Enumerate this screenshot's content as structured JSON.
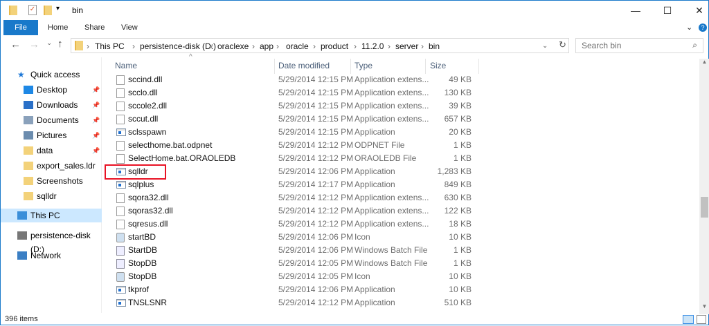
{
  "window": {
    "title": "bin",
    "minimize": "—",
    "maximize": "☐",
    "close": "✕"
  },
  "ribbon": {
    "tabs": [
      "File",
      "Home",
      "Share",
      "View"
    ],
    "expand": "⌄",
    "help": "?"
  },
  "nav": {
    "back": "←",
    "forward": "→",
    "recent": "⌄",
    "up": "↑",
    "refresh": "↻",
    "breadcrumbs": [
      "This PC",
      "persistence-disk (D:)",
      "oraclexe",
      "app",
      "oracle",
      "product",
      "11.2.0",
      "server",
      "bin"
    ],
    "search_placeholder": "Search bin"
  },
  "sidebar": [
    {
      "label": "Quick access",
      "icon": "star-icon"
    },
    {
      "label": "Desktop",
      "icon": "desktop-icon",
      "pinned": true
    },
    {
      "label": "Downloads",
      "icon": "download-icon",
      "pinned": true
    },
    {
      "label": "Documents",
      "icon": "documents-icon",
      "pinned": true
    },
    {
      "label": "Pictures",
      "icon": "pictures-icon",
      "pinned": true
    },
    {
      "label": "data",
      "icon": "folder-icon",
      "pinned": true
    },
    {
      "label": "export_sales.ldr",
      "icon": "folder-icon"
    },
    {
      "label": "Screenshots",
      "icon": "folder-icon"
    },
    {
      "label": "sqlldr",
      "icon": "folder-icon"
    },
    {
      "label": "This PC",
      "icon": "computer-icon",
      "selected": true
    },
    {
      "label": "persistence-disk (D:)",
      "icon": "drive-icon"
    },
    {
      "label": "Network",
      "icon": "network-icon"
    }
  ],
  "columns": [
    "Name",
    "Date modified",
    "Type",
    "Size"
  ],
  "files": [
    {
      "name": "sccind.dll",
      "date": "5/29/2014 12:15 PM",
      "type": "Application extens...",
      "size": "49 KB",
      "kind": "dll"
    },
    {
      "name": "scclo.dll",
      "date": "5/29/2014 12:15 PM",
      "type": "Application extens...",
      "size": "130 KB",
      "kind": "dll"
    },
    {
      "name": "sccole2.dll",
      "date": "5/29/2014 12:15 PM",
      "type": "Application extens...",
      "size": "39 KB",
      "kind": "dll"
    },
    {
      "name": "sccut.dll",
      "date": "5/29/2014 12:15 PM",
      "type": "Application extens...",
      "size": "657 KB",
      "kind": "dll"
    },
    {
      "name": "sclsspawn",
      "date": "5/29/2014 12:15 PM",
      "type": "Application",
      "size": "20 KB",
      "kind": "app"
    },
    {
      "name": "selecthome.bat.odpnet",
      "date": "5/29/2014 12:12 PM",
      "type": "ODPNET File",
      "size": "1 KB",
      "kind": "file"
    },
    {
      "name": "SelectHome.bat.ORAOLEDB",
      "date": "5/29/2014 12:12 PM",
      "type": "ORAOLEDB File",
      "size": "1 KB",
      "kind": "file"
    },
    {
      "name": "sqlldr",
      "date": "5/29/2014 12:06 PM",
      "type": "Application",
      "size": "1,283 KB",
      "kind": "app"
    },
    {
      "name": "sqlplus",
      "date": "5/29/2014 12:17 PM",
      "type": "Application",
      "size": "849 KB",
      "kind": "app"
    },
    {
      "name": "sqora32.dll",
      "date": "5/29/2014 12:12 PM",
      "type": "Application extens...",
      "size": "630 KB",
      "kind": "dll"
    },
    {
      "name": "sqoras32.dll",
      "date": "5/29/2014 12:12 PM",
      "type": "Application extens...",
      "size": "122 KB",
      "kind": "dll"
    },
    {
      "name": "sqresus.dll",
      "date": "5/29/2014 12:12 PM",
      "type": "Application extens...",
      "size": "18 KB",
      "kind": "dll"
    },
    {
      "name": "startBD",
      "date": "5/29/2014 12:06 PM",
      "type": "Icon",
      "size": "10 KB",
      "kind": "ico"
    },
    {
      "name": "StartDB",
      "date": "5/29/2014 12:06 PM",
      "type": "Windows Batch File",
      "size": "1 KB",
      "kind": "bat"
    },
    {
      "name": "StopDB",
      "date": "5/29/2014 12:05 PM",
      "type": "Windows Batch File",
      "size": "1 KB",
      "kind": "bat"
    },
    {
      "name": "StopDB",
      "date": "5/29/2014 12:05 PM",
      "type": "Icon",
      "size": "10 KB",
      "kind": "ico"
    },
    {
      "name": "tkprof",
      "date": "5/29/2014 12:06 PM",
      "type": "Application",
      "size": "10 KB",
      "kind": "app"
    },
    {
      "name": "TNSLSNR",
      "date": "5/29/2014 12:12 PM",
      "type": "Application",
      "size": "510 KB",
      "kind": "app"
    }
  ],
  "status": {
    "count": "396 items"
  }
}
